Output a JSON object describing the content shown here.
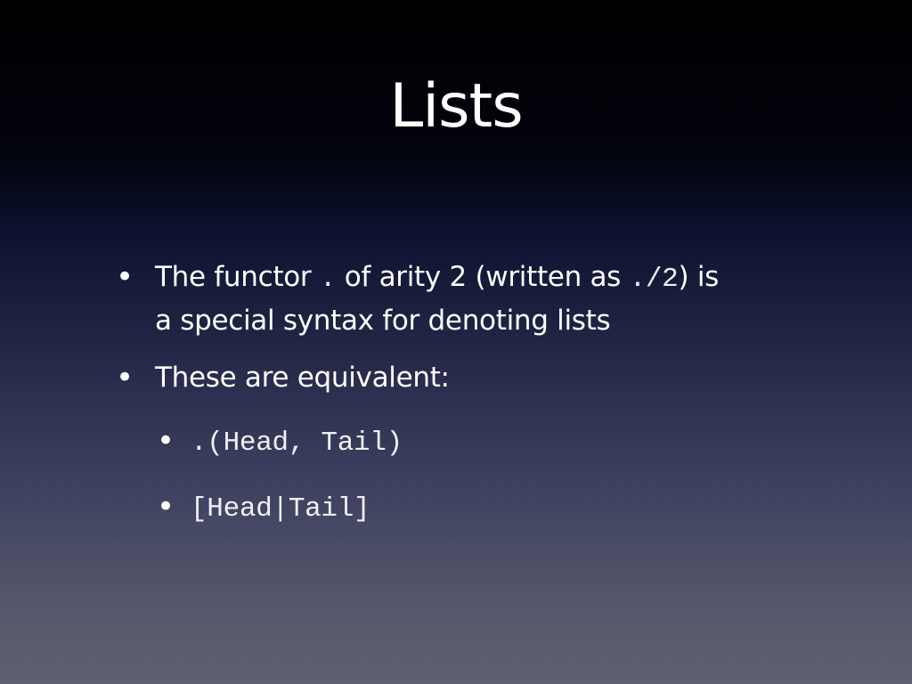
{
  "slide": {
    "title": "Lists",
    "bullets": [
      {
        "bullet_glyph": "•",
        "text_before_code1": "The functor ",
        "code1": ".",
        "text_between": " of arity 2 (written as ",
        "code2": "./2",
        "text_after": ") is",
        "continuation": "a special syntax for denoting lists"
      },
      {
        "bullet_glyph": "•",
        "text": "These are equivalent:"
      }
    ],
    "sub_bullets": [
      {
        "bullet_glyph": "•",
        "code": ".(Head, Tail)"
      },
      {
        "bullet_glyph": "•",
        "code": "[Head|Tail]"
      }
    ]
  },
  "colors": {
    "background_top": "#000000",
    "background_bottom": "#5e6073",
    "text": "#ffffff"
  }
}
